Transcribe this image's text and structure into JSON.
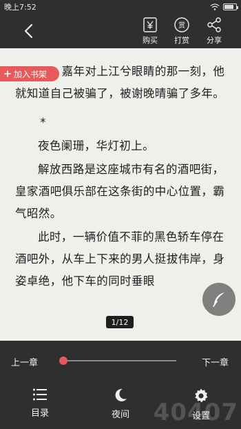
{
  "status_bar": {
    "time": "晚上7:52"
  },
  "top_bar": {
    "buy_label": "购买",
    "reward_label": "打赏",
    "share_label": "分享"
  },
  "reader": {
    "add_to_shelf": "加入书架",
    "paragraphs": [
      "嘉年对上江兮眼睛的那一刻，他就知道自己被骗了，被谢晚晴骗了多年。",
      "*",
      "夜色阑珊，华灯初上。",
      "解放西路是这座城市有名的酒吧街，皇家酒吧俱乐部在这条街的中心位置，霸气昭然。",
      "此时，一辆价值不菲的黑色轿车停在酒吧外，从车上下来的男人挺拔伟岸，身姿卓绝，他下车的同时垂眼"
    ],
    "page_indicator": "1/12"
  },
  "bottom": {
    "prev_chapter": "上一章",
    "next_chapter": "下一章",
    "progress": 0.0,
    "toc_label": "目录",
    "night_label": "夜间",
    "settings_label": "设置",
    "watermark": "40407"
  },
  "colors": {
    "accent": "#e8595c",
    "page_bg": "#efefec",
    "bar_bg": "#2f2f2f"
  }
}
